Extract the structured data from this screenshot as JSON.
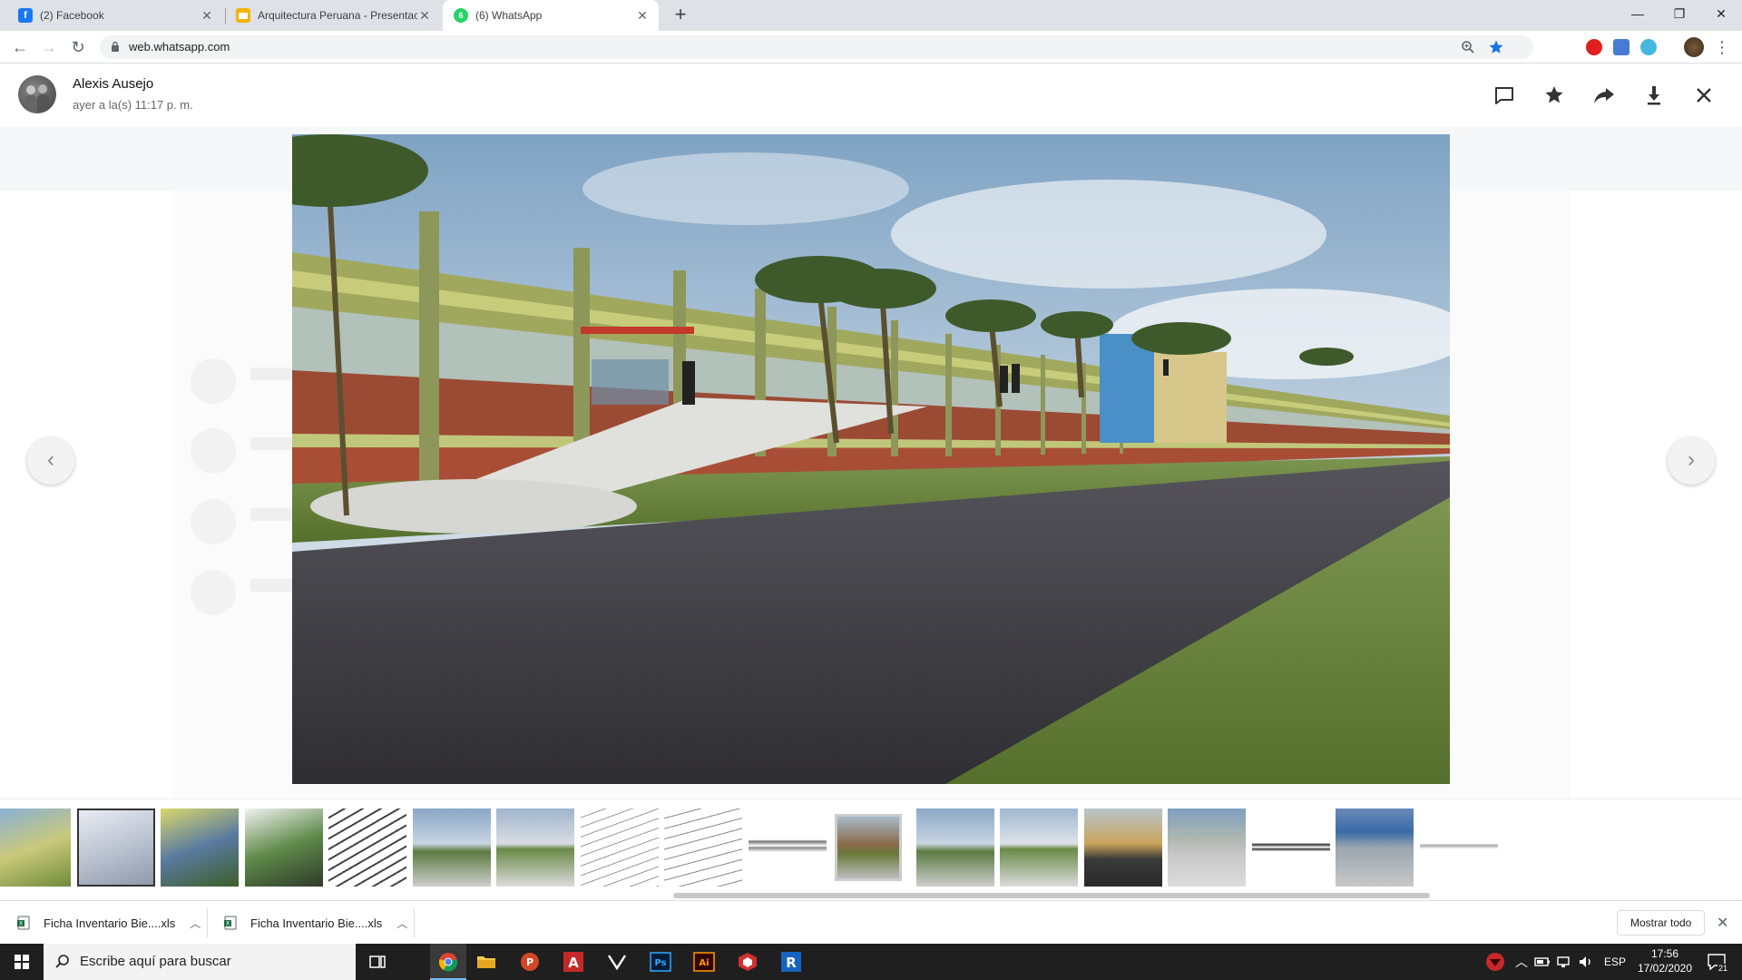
{
  "browser": {
    "tabs": [
      {
        "label": "(2) Facebook",
        "icon": "facebook-icon"
      },
      {
        "label": "Arquitectura Peruana - Presentac",
        "icon": "slides-icon"
      },
      {
        "label": "(6) WhatsApp",
        "icon": "whatsapp-icon"
      }
    ],
    "url": "web.whatsapp.com"
  },
  "viewer": {
    "sender_name": "Alexis Ausejo",
    "timestamp": "ayer a la(s) 11:17 p. m.",
    "actions": [
      "chat-icon",
      "star-icon",
      "forward-icon",
      "download-icon",
      "close-icon"
    ]
  },
  "downloads": {
    "items": [
      {
        "label": "Ficha Inventario Bie....xls"
      },
      {
        "label": "Ficha Inventario Bie....xls"
      }
    ],
    "show_all": "Mostrar todo"
  },
  "taskbar": {
    "search_placeholder": "Escribe aquí para buscar",
    "language": "ESP",
    "time": "17:56",
    "date": "17/02/2020",
    "notifications": "21"
  },
  "colors": {
    "tabbar_bg": "#dee1e6",
    "whatsapp_green": "#25d366",
    "facebook_blue": "#1877f2",
    "taskbar_bg": "#1f1f1f"
  }
}
